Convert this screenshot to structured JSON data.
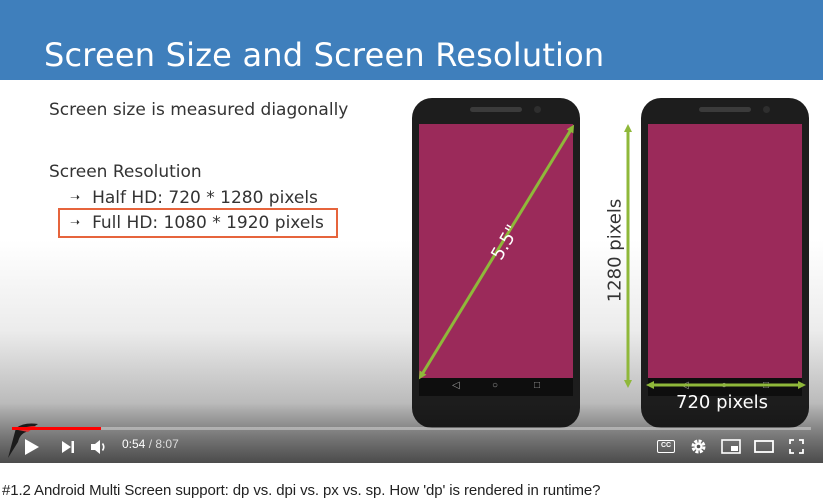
{
  "slide": {
    "title": "Screen Size and Screen Resolution",
    "line1": "Screen size is measured diagonally",
    "resolution_heading": "Screen Resolution",
    "bullet_half": "Half HD: 720 * 1280 pixels",
    "bullet_full": "Full HD: 1080 * 1920 pixels",
    "bullet_arrow": "➝",
    "label_diagonal": "5.5\"",
    "label_height": "1280 pixels",
    "label_width": "720 pixels"
  },
  "colors": {
    "title_bar": "#3f7fbc",
    "phone_screen": "#9b2a5a",
    "dimension_lines": "#8fb83a",
    "highlight_box": "#e6643c",
    "progress_played": "#ff0000"
  },
  "player": {
    "current_time": "0:54",
    "separator": "/",
    "duration": "8:07",
    "progress_fraction": 0.111,
    "icons": [
      "play-icon",
      "next-icon",
      "volume-icon",
      "subtitles-icon",
      "settings-icon",
      "miniplayer-icon",
      "theater-icon",
      "fullscreen-icon"
    ],
    "captions_label": "CC"
  },
  "video": {
    "title": "#1.2 Android Multi Screen support: dp vs. dpi vs. px vs. sp. How 'dp' is rendered in runtime?"
  }
}
